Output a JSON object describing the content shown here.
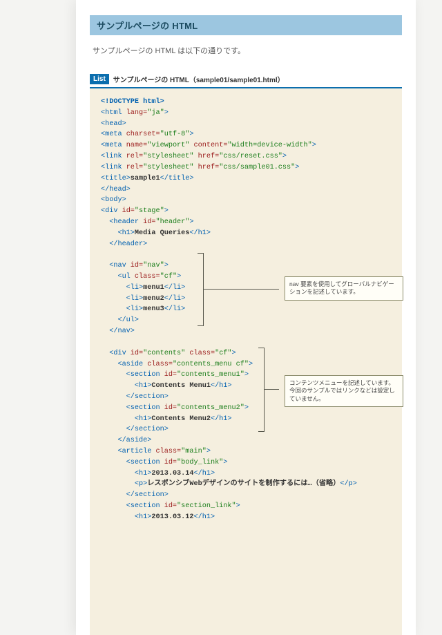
{
  "header": {
    "title": "サンプルページの HTML",
    "intro": "サンプルページの HTML は以下の通りです。"
  },
  "listing": {
    "badge": "List",
    "caption": "サンプルページの HTML（sample01/sample01.html）"
  },
  "annotations": {
    "nav": "nav 要素を使用してグローバルナビゲーションを記述しています。",
    "aside": "コンテンツメニューを記述しています。今回のサンプルではリンクなどは設定していません。"
  },
  "code": {
    "line01": "<!DOCTYPE html>",
    "line02a": "<html ",
    "line02b": "lang=",
    "line02c": "\"ja\"",
    "line02d": ">",
    "line03": "<head>",
    "line04a": "<meta ",
    "line04b": "charset=",
    "line04c": "\"utf-8\"",
    "line04d": ">",
    "line05a": "<meta ",
    "line05b": "name=",
    "line05c": "\"viewport\"",
    "line05d": " content=",
    "line05e": "\"width=device-width\"",
    "line05f": ">",
    "line06a": "<link ",
    "line06b": "rel=",
    "line06c": "\"stylesheet\"",
    "line06d": " href=",
    "line06e": "\"css/reset.css\"",
    "line06f": ">",
    "line07a": "<link ",
    "line07b": "rel=",
    "line07c": "\"stylesheet\"",
    "line07d": " href=",
    "line07e": "\"css/sample01.css\"",
    "line07f": ">",
    "line08a": "<title>",
    "line08b": "sample1",
    "line08c": "</title>",
    "line09": "</head>",
    "line10": "<body>",
    "line11a": "<div ",
    "line11b": "id=",
    "line11c": "\"stage\"",
    "line11d": ">",
    "line12a": "  <header ",
    "line12b": "id=",
    "line12c": "\"header\"",
    "line12d": ">",
    "line13a": "    <h1>",
    "line13b": "Media Queries",
    "line13c": "</h1>",
    "line14": "  </header>",
    "blank1": "",
    "line15a": "  <nav ",
    "line15b": "id=",
    "line15c": "\"nav\"",
    "line15d": ">",
    "line16a": "    <ul ",
    "line16b": "class=",
    "line16c": "\"cf\"",
    "line16d": ">",
    "line17a": "      <li>",
    "line17b": "menu1",
    "line17c": "</li>",
    "line18a": "      <li>",
    "line18b": "menu2",
    "line18c": "</li>",
    "line19a": "      <li>",
    "line19b": "menu3",
    "line19c": "</li>",
    "line20": "    </ul>",
    "line21": "  </nav>",
    "blank2": "",
    "line22a": "  <div ",
    "line22b": "id=",
    "line22c": "\"contents\"",
    "line22d": " class=",
    "line22e": "\"cf\"",
    "line22f": ">",
    "line23a": "    <aside ",
    "line23b": "class=",
    "line23c": "\"contents_menu cf\"",
    "line23d": ">",
    "line24a": "      <section ",
    "line24b": "id=",
    "line24c": "\"contents_menu1\"",
    "line24d": ">",
    "line25a": "        <h1>",
    "line25b": "Contents Menu1",
    "line25c": "</h1>",
    "line26": "      </section>",
    "line27a": "      <section ",
    "line27b": "id=",
    "line27c": "\"contents_menu2\"",
    "line27d": ">",
    "line28a": "        <h1>",
    "line28b": "Contents Menu2",
    "line28c": "</h1>",
    "line29": "      </section>",
    "line30": "    </aside>",
    "line31a": "    <article ",
    "line31b": "class=",
    "line31c": "\"main\"",
    "line31d": ">",
    "line32a": "      <section ",
    "line32b": "id=",
    "line32c": "\"body_link\"",
    "line32d": ">",
    "line33a": "        <h1>",
    "line33b": "2013.03.14",
    "line33c": "</h1>",
    "line34a": "        <p>",
    "line34b": "レスポンシブWebデザインのサイトを制作するには…（省略）",
    "line34c": "</p>",
    "line35": "      </section>",
    "line36a": "      <section ",
    "line36b": "id=",
    "line36c": "\"section_link\"",
    "line36d": ">",
    "line37a": "        <h1>",
    "line37b": "2013.03.12",
    "line37c": "</h1>"
  }
}
